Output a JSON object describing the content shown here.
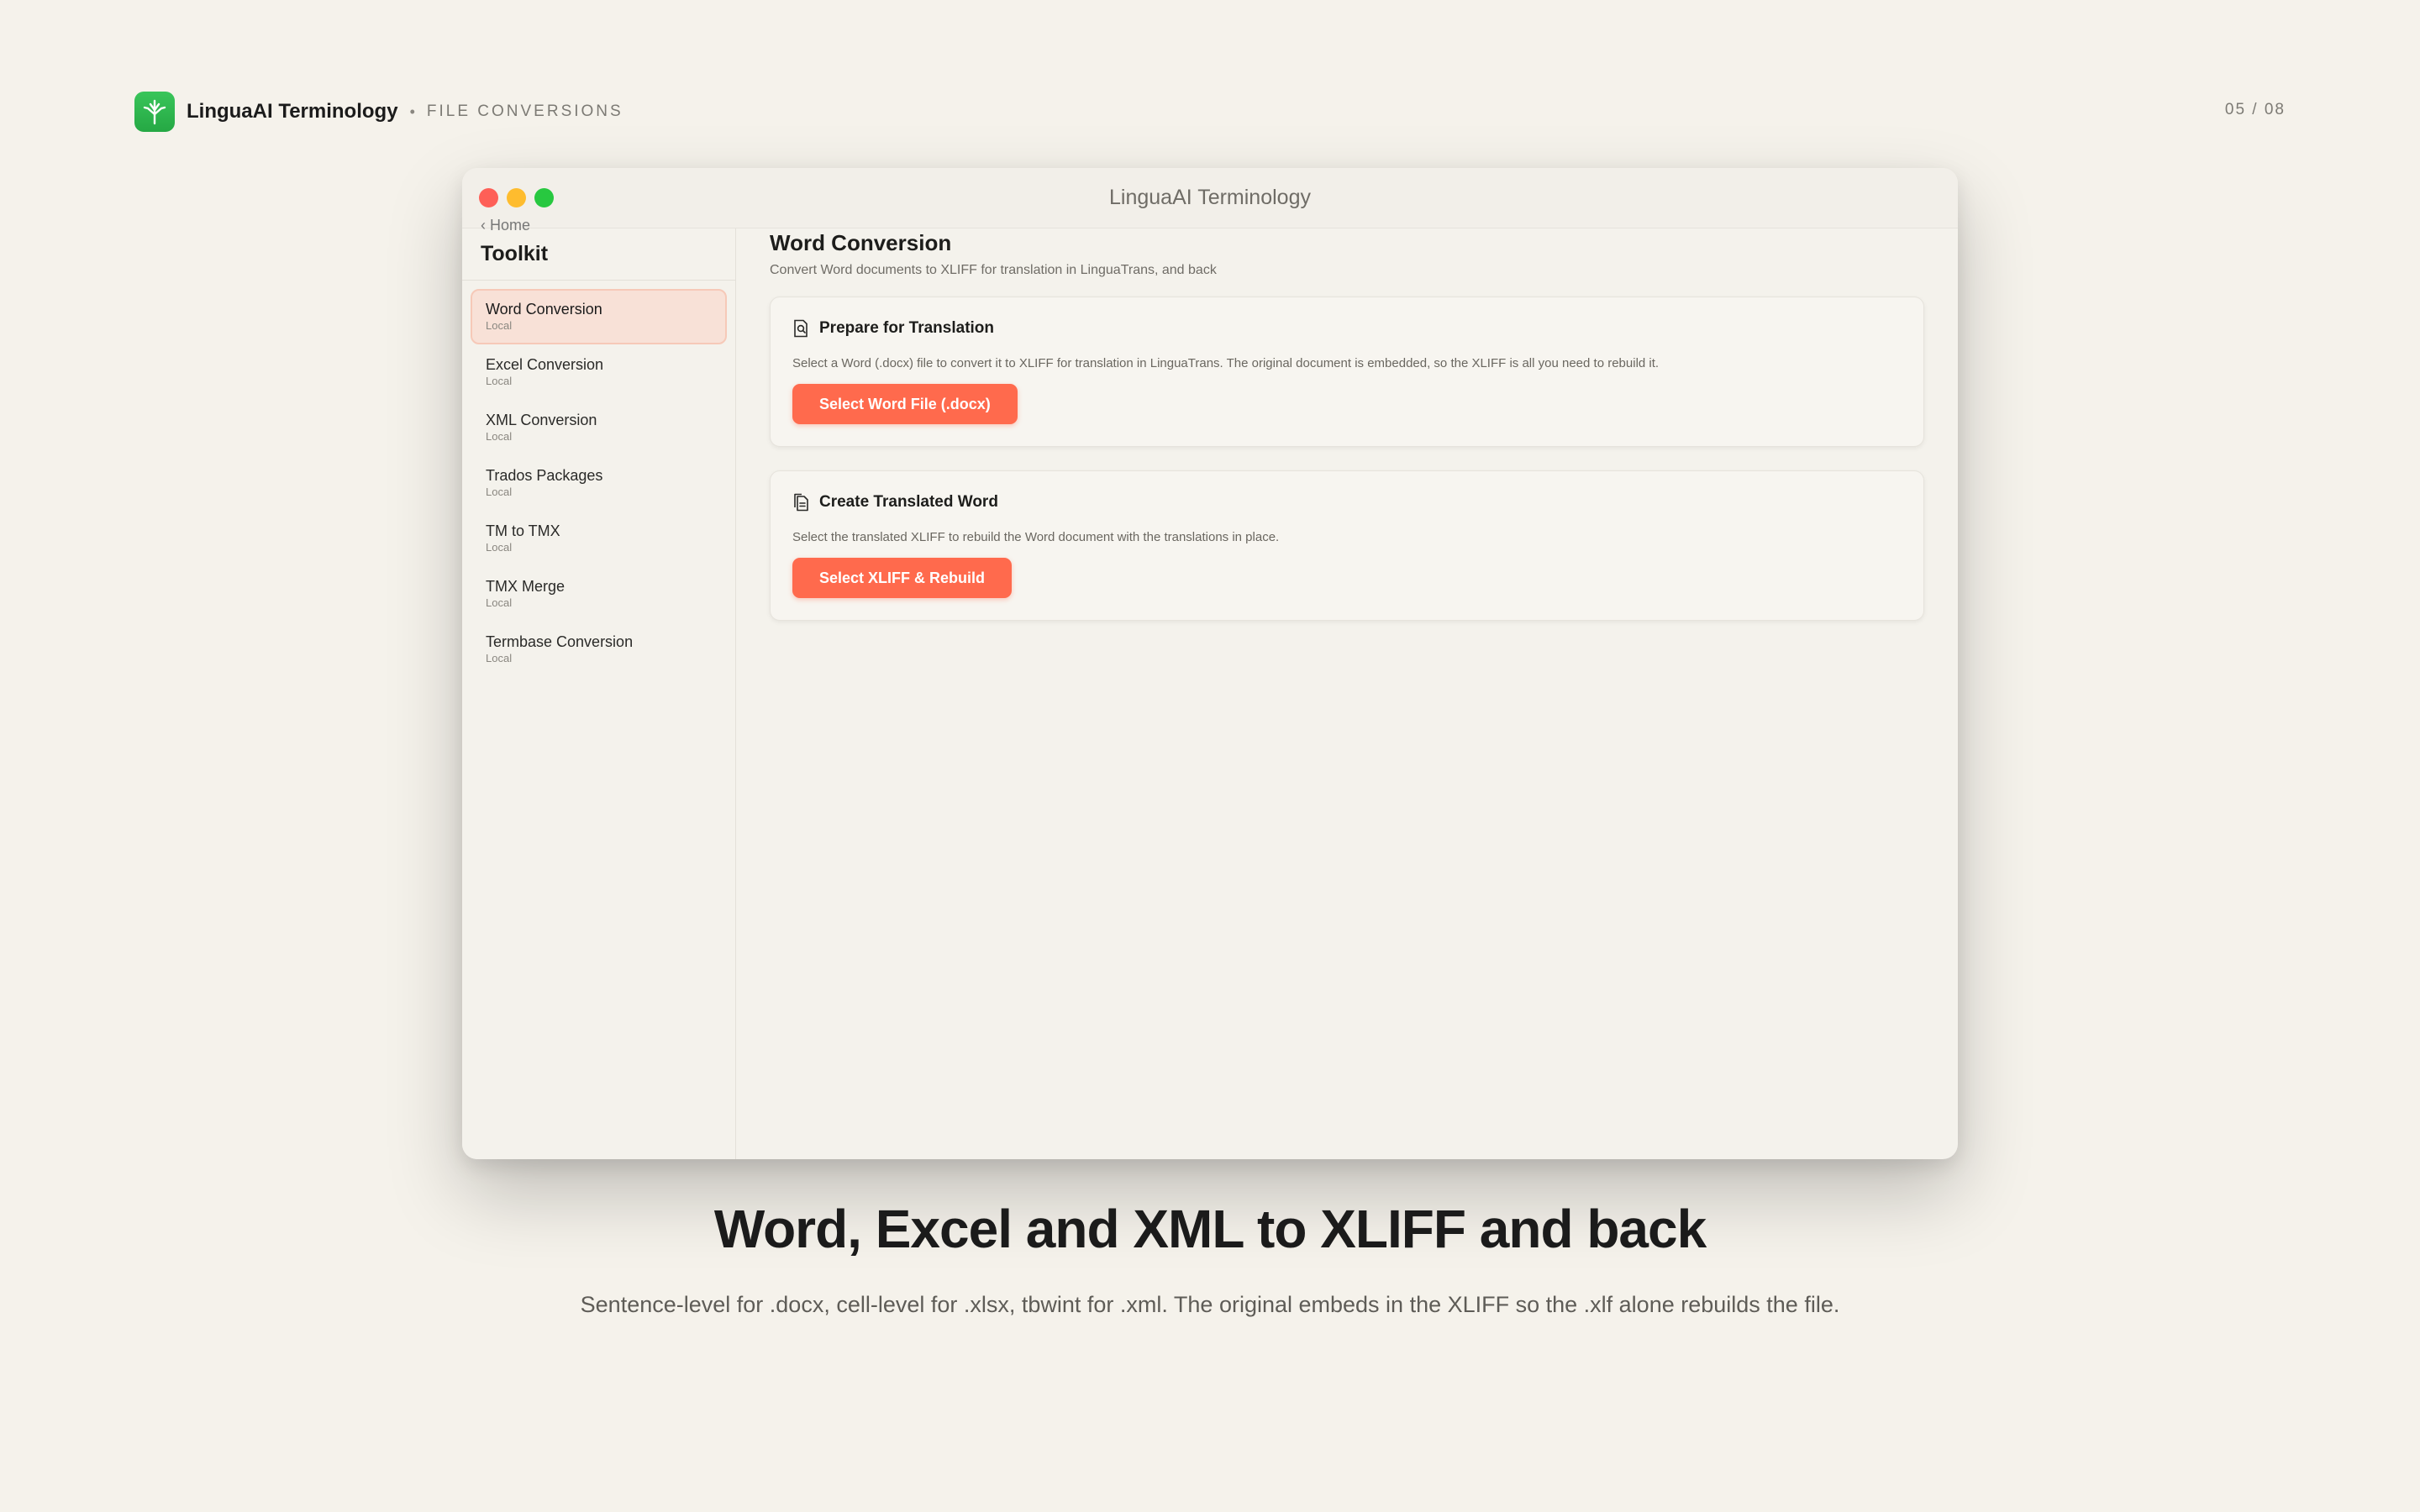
{
  "topbar": {
    "brand": "LinguaAI Terminology",
    "separator": "•",
    "section": "FILE CONVERSIONS",
    "pager": "05 / 08",
    "app_icon": "tree-icon"
  },
  "window": {
    "title": "LinguaAI Terminology"
  },
  "sidebar": {
    "back_label": "‹ Home",
    "title": "Toolkit",
    "items": [
      {
        "label": "Word Conversion",
        "sub": "Local",
        "active": true
      },
      {
        "label": "Excel Conversion",
        "sub": "Local"
      },
      {
        "label": "XML Conversion",
        "sub": "Local"
      },
      {
        "label": "Trados Packages",
        "sub": "Local"
      },
      {
        "label": "TM to TMX",
        "sub": "Local"
      },
      {
        "label": "TMX Merge",
        "sub": "Local"
      },
      {
        "label": "Termbase Conversion",
        "sub": "Local"
      }
    ]
  },
  "main": {
    "title": "Word Conversion",
    "subtitle": "Convert Word documents to XLIFF for translation in LinguaTrans, and back",
    "cards": [
      {
        "icon": "document-search-icon",
        "title": "Prepare for Translation",
        "description": "Select a Word (.docx) file to convert it to XLIFF for translation in LinguaTrans. The original document is embedded, so the XLIFF is all you need to rebuild it.",
        "button": "Select Word File (.docx)"
      },
      {
        "icon": "documents-icon",
        "title": "Create Translated Word",
        "description": "Select the translated XLIFF to rebuild the Word document with the translations in place.",
        "button": "Select XLIFF & Rebuild"
      }
    ]
  },
  "caption": {
    "headline": "Word, Excel and XML to XLIFF and back",
    "subline": "Sentence-level for .docx, cell-level for .xlsx, tbwint for .xml. The original embeds in the XLIFF so the .xlf alone rebuilds the file."
  },
  "colors": {
    "background": "#f5f2eb",
    "accent": "#ff6a4d",
    "active_item": "#f8e1d7",
    "brand_green": "#34c759"
  }
}
